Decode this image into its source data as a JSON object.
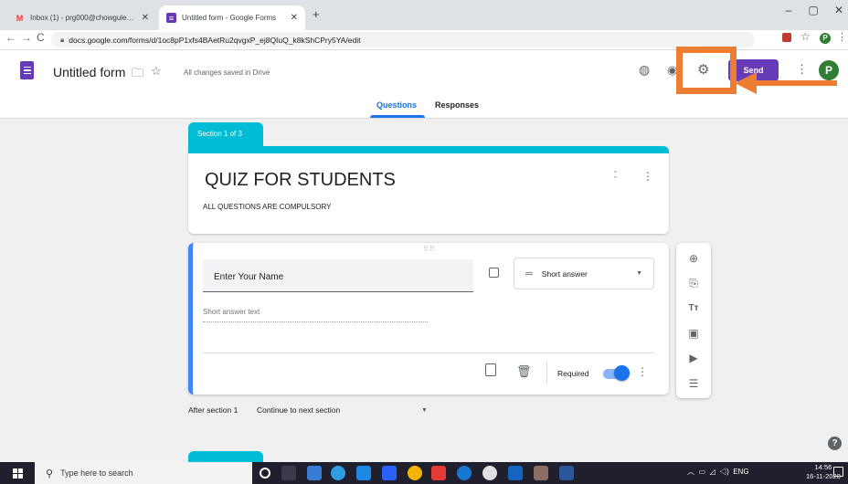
{
  "browser": {
    "tabs": [
      {
        "label": "Inbox (1) - prg000@chowgules.a",
        "favicon": "gmail-icon",
        "active": false
      },
      {
        "label": "Untitled form - Google Forms",
        "favicon": "forms-icon",
        "active": true
      }
    ],
    "new_tab": "+",
    "url": "docs.google.com/forms/d/1oc8pP1xfs4BAetRu2qvgxP_ej8QIuQ_k8kShCPry5YA/edit",
    "window": {
      "minimize": "–",
      "maximize": "▢",
      "close": "✕"
    }
  },
  "header": {
    "form_title": "Untitled form",
    "save_status": "All changes saved in Drive",
    "send_label": "Send",
    "avatar_letter": "P",
    "accent": "#673ab7"
  },
  "tabs": {
    "questions": "Questions",
    "responses": "Responses"
  },
  "section": {
    "tag": "Section 1 of 3",
    "title": "QUIZ FOR STUDENTS",
    "description": "ALL QUESTIONS ARE COMPULSORY",
    "color": "#00bcd4"
  },
  "question": {
    "title": "Enter Your Name",
    "type": "Short answer",
    "answer_hint": "Short answer text",
    "required_label": "Required",
    "required": true
  },
  "after_section": {
    "label": "After section 1",
    "value": "Continue to next section"
  },
  "taskbar": {
    "search_placeholder": "Type here to search",
    "lang": "ENG",
    "time": "14:56",
    "date": "16-11-2020"
  },
  "annotation": {
    "color": "#ed7d31",
    "target": "settings-icon"
  }
}
